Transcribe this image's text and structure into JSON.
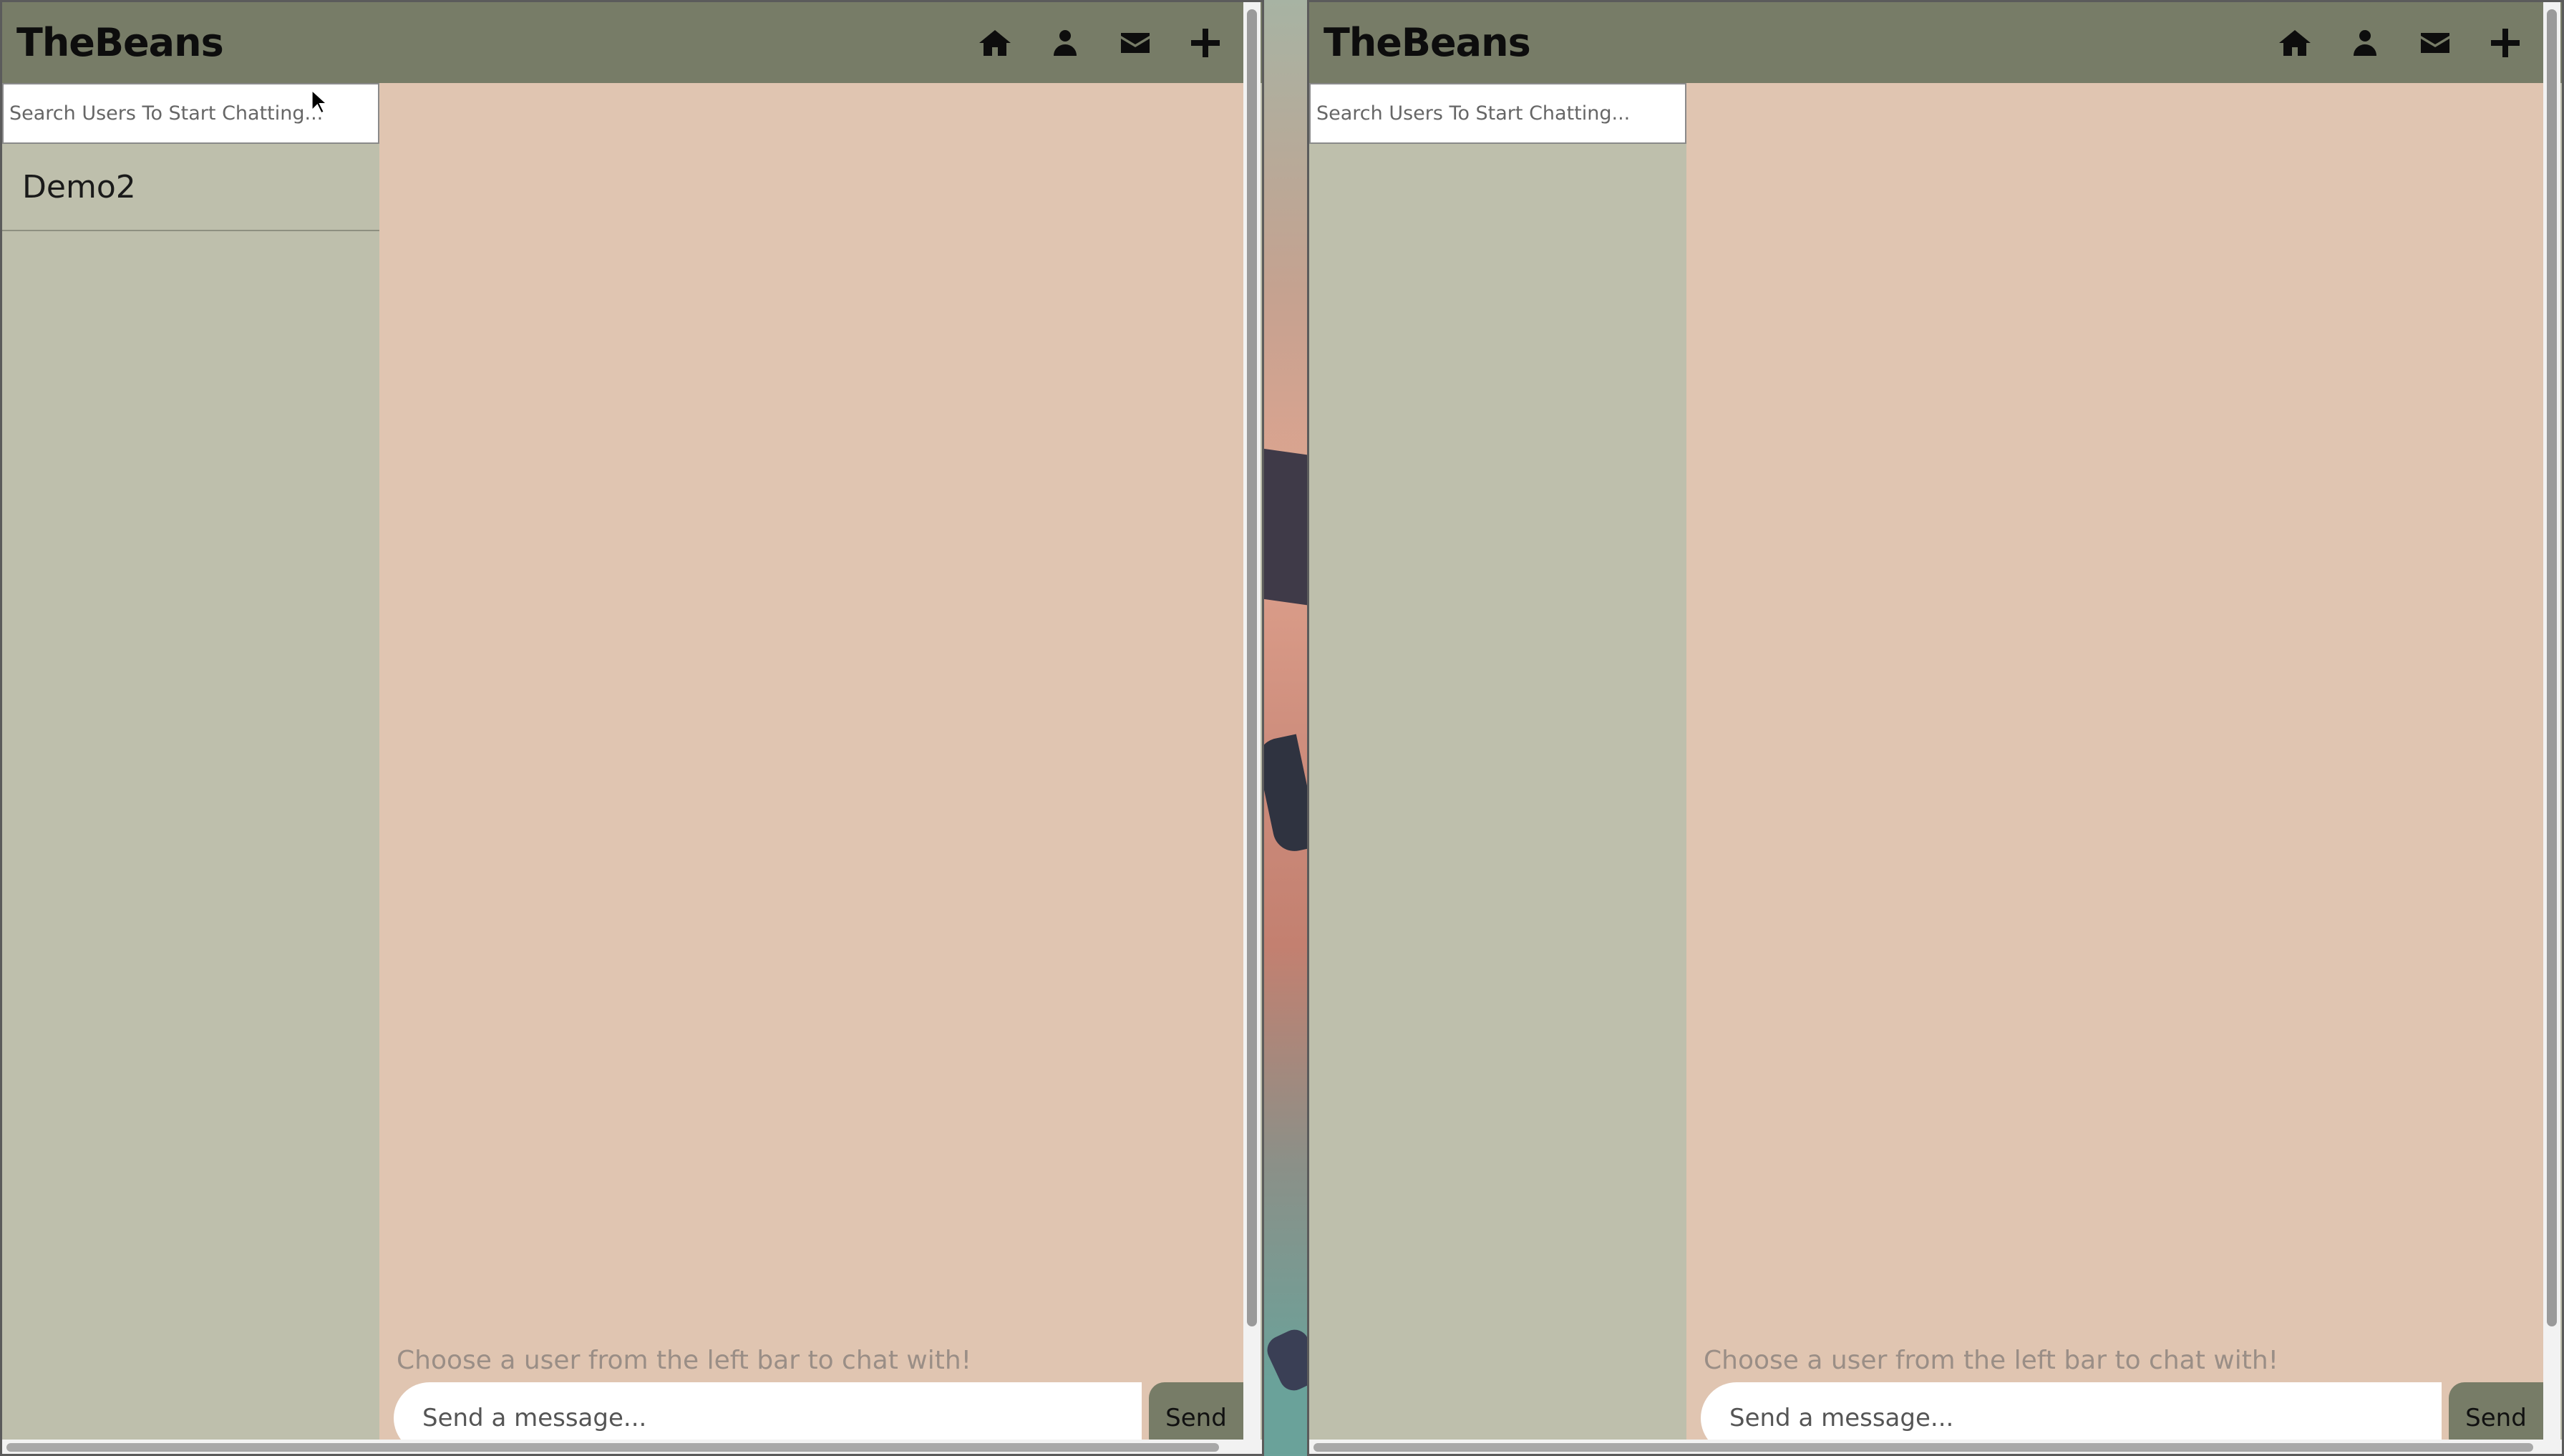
{
  "windows": [
    {
      "brand": "TheBeans",
      "nav": {
        "home": "home-icon",
        "profile": "user-icon",
        "messages": "envelope-icon",
        "create": "plus-icon"
      },
      "search_placeholder": "Search Users To Start Chatting...",
      "users": [
        "Demo2"
      ],
      "chat_hint": "Choose a user from the left bar to chat with!",
      "message_placeholder": "Send a message...",
      "send_label": "Send"
    },
    {
      "brand": "TheBeans",
      "nav": {
        "home": "home-icon",
        "profile": "user-icon",
        "messages": "envelope-icon",
        "create": "plus-icon"
      },
      "search_placeholder": "Search Users To Start Chatting...",
      "users": [],
      "chat_hint": "Choose a user from the left bar to chat with!",
      "message_placeholder": "Send a message...",
      "send_label": "Send"
    }
  ],
  "colors": {
    "navbar": "#777c67",
    "sidebar": "#bebfac",
    "chat_background": "#e0c5b1",
    "send_button": "#777c67"
  }
}
